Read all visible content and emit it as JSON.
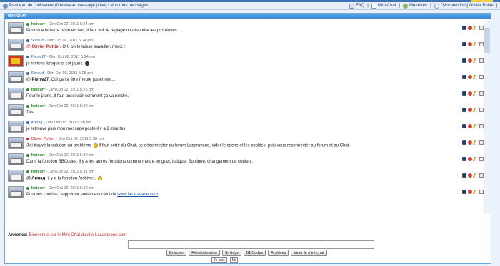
{
  "nav": {
    "left": "Panneau de l'utilisateur (0 nouveau message privé) • Voir mes messages",
    "faq": "FAQ",
    "mini_chat": "Mini-Chat",
    "members": "Membres",
    "logout": "Déconnexion [ Olivier Pottier ]"
  },
  "chat": {
    "title": "MINI-CHAT",
    "messages": [
      {
        "author": "freteurr",
        "date": "Dim Oct 02, 2011 5:24 pm",
        "body": "Pour que le barre reste en bas, il faut voir le réglage ou résoudre les problèmes.",
        "mention": ""
      },
      {
        "author": "Soraud",
        "date": "Dim Oct 02, 2011 5:24 pm",
        "mention": "@ Olivier Pottier",
        "body": ", OK, on te laisse travailler, merci !"
      },
      {
        "author": "Pierre27",
        "date": "Dim Oct 02, 2011 5:24 pm",
        "body": "je reviens lorsque c' est jaune",
        "mention": ""
      },
      {
        "author": "Soraud",
        "date": "Dim Oct 02, 2011 5:25 pm",
        "mention": "@ Pierre27",
        "body": ", Oui ça va être l'heure justement..."
      },
      {
        "author": "freteurr",
        "date": "Dim Oct 02, 2011 5:26 pm",
        "body": "Pour le jaune, il faut aussi voir comment ça va rendre,",
        "mention": ""
      },
      {
        "author": "freteurr",
        "date": "Dim Oct 02, 2011 5:28 pm",
        "body": "Test",
        "mention": ""
      },
      {
        "author": "Armag",
        "date": "Dim Oct 02, 2011 5:28 pm",
        "body": "je retrouve plus mon message posté il y a 2 minutes",
        "mention": ""
      },
      {
        "author": "Olivier Pottier",
        "date": "Dim Oct 02, 2011 5:30 pm",
        "body": "J'ai trouvé la solution au problème",
        "body2": "Il faut sortir du Chat, se déconnecter du forum Lacaravane, vider le cache et les cookies, puis vous reconnecter au forum et au Chat.",
        "mention": ""
      },
      {
        "author": "freteurr",
        "date": "Dim Oct 02, 2011 5:30 pm",
        "body": "Dans la fonction BBCodes, il y a les autres fonctions comme mettre en gras, italique, Souligné, changement de couleur.",
        "mention": ""
      },
      {
        "author": "freteurr",
        "date": "Dim Oct 02, 2011 5:31 pm",
        "mention": "@ Armag",
        "body": ", il y a la fonction Archives."
      },
      {
        "author": "freteurr",
        "date": "Dim Oct 02, 2011 5:32 pm",
        "body": "Pour les cookies, supprimer seulement celui de",
        "link": "www.lacaravane.com",
        "mention": ""
      }
    ],
    "announce_label": "Annonce:",
    "announce_text": "Bienvenue sur le Mini Chat du site Lacaravane.com",
    "buttons": [
      "Envoyer",
      "Réinitialisation",
      "Smileys",
      "BBCodes",
      "Archives",
      "Vider le mini-chat"
    ],
    "bottom_chip1": "Je suis",
    "bottom_chip2": "Mr",
    "colors": {
      "accent": "#2f86d4",
      "author": "#2f8f2f",
      "announce": "#c22b2b"
    }
  }
}
